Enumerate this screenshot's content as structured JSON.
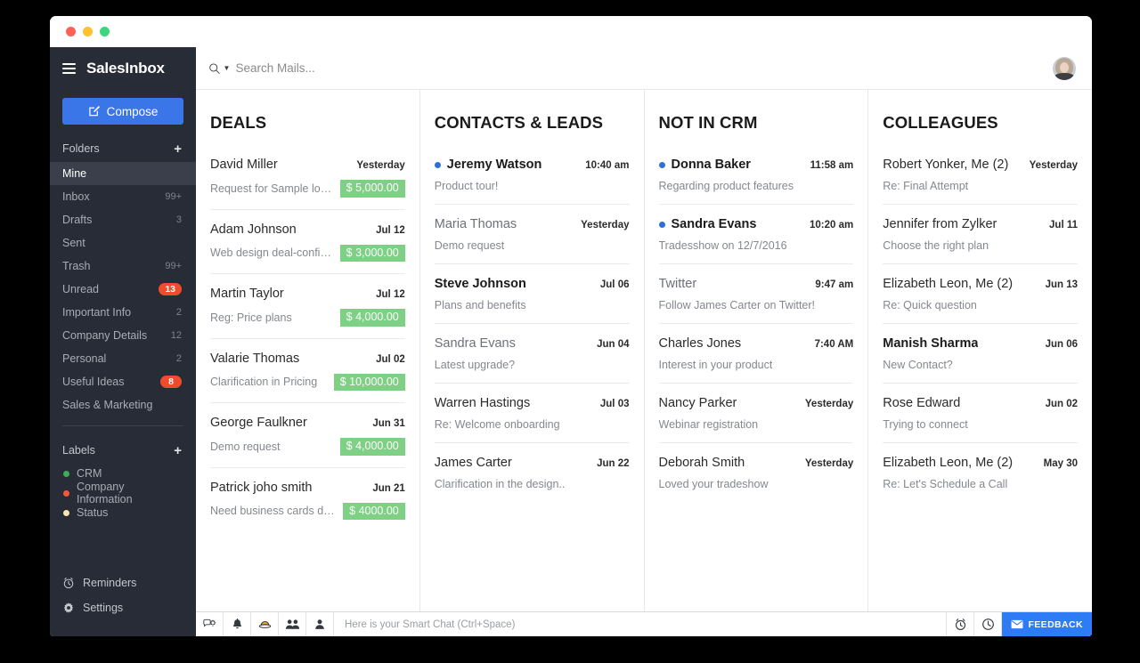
{
  "window": {
    "traffic_lights": [
      "close",
      "minimize",
      "maximize"
    ]
  },
  "sidebar": {
    "brand": "SalesInbox",
    "compose_label": "Compose",
    "folders_heading": "Folders",
    "folders_add": "+",
    "folders": [
      {
        "label": "Mine",
        "count": "",
        "badge": false,
        "active": true
      },
      {
        "label": "Inbox",
        "count": "99+",
        "badge": false,
        "active": false
      },
      {
        "label": "Drafts",
        "count": "3",
        "badge": false,
        "active": false
      },
      {
        "label": "Sent",
        "count": "",
        "badge": false,
        "active": false
      },
      {
        "label": "Trash",
        "count": "99+",
        "badge": false,
        "active": false
      },
      {
        "label": "Unread",
        "count": "13",
        "badge": true,
        "active": false
      },
      {
        "label": "Important Info",
        "count": "2",
        "badge": false,
        "active": false
      },
      {
        "label": "Company Details",
        "count": "12",
        "badge": false,
        "active": false
      },
      {
        "label": "Personal",
        "count": "2",
        "badge": false,
        "active": false
      },
      {
        "label": "Useful Ideas",
        "count": "8",
        "badge": true,
        "active": false
      },
      {
        "label": "Sales & Marketing",
        "count": "",
        "badge": false,
        "active": false
      }
    ],
    "labels_heading": "Labels",
    "labels_add": "+",
    "labels": [
      {
        "label": "CRM",
        "color": "#3cae5b"
      },
      {
        "label": "Company Information",
        "color": "#f0593a"
      },
      {
        "label": "Status",
        "color": "#f7e7b4"
      }
    ],
    "bottom": [
      {
        "label": "Reminders",
        "icon": "alarm-clock-icon"
      },
      {
        "label": "Settings",
        "icon": "gear-icon"
      }
    ]
  },
  "topbar": {
    "search_placeholder": "Search Mails...",
    "search_value": "",
    "search_icon": "search-icon",
    "search_caret": "chevron-down-icon",
    "avatar": "user-avatar"
  },
  "columns": [
    {
      "title": "DEALS",
      "items": [
        {
          "name": "David Miller",
          "date": "Yesterday",
          "subject": "Request for Sample logo...",
          "amount": "$ 5,000.00",
          "unread": false,
          "name_style": "dark"
        },
        {
          "name": "Adam Johnson",
          "date": "Jul 12",
          "subject": "Web design deal-confirma...",
          "amount": "$ 3,000.00",
          "unread": false,
          "name_style": "dark"
        },
        {
          "name": "Martin Taylor",
          "date": "Jul 12",
          "subject": "Reg: Price plans",
          "amount": "$ 4,000.00",
          "unread": false,
          "name_style": "dark"
        },
        {
          "name": "Valarie Thomas",
          "date": "Jul 02",
          "subject": "Clarification in Pricing",
          "amount": "$ 10,000.00",
          "unread": false,
          "name_style": "dark"
        },
        {
          "name": "George Faulkner",
          "date": "Jun 31",
          "subject": "Demo request",
          "amount": "$ 4,000.00",
          "unread": false,
          "name_style": "dark"
        },
        {
          "name": "Patrick joho smith",
          "date": "Jun 21",
          "subject": "Need business cards desi....",
          "amount": "$ 4000.00",
          "unread": false,
          "name_style": "dark"
        }
      ]
    },
    {
      "title": "CONTACTS & LEADS",
      "items": [
        {
          "name": "Jeremy Watson",
          "date": "10:40 am",
          "subject": "Product tour!",
          "amount": "",
          "unread": true,
          "name_style": "bold"
        },
        {
          "name": "Maria Thomas",
          "date": "Yesterday",
          "subject": "Demo request",
          "amount": "",
          "unread": false,
          "name_style": "light"
        },
        {
          "name": "Steve Johnson",
          "date": "Jul 06",
          "subject": "Plans and benefits",
          "amount": "",
          "unread": false,
          "name_style": "bold"
        },
        {
          "name": "Sandra Evans",
          "date": "Jun 04",
          "subject": "Latest upgrade?",
          "amount": "",
          "unread": false,
          "name_style": "light"
        },
        {
          "name": "Warren Hastings",
          "date": "Jul 03",
          "subject": "Re: Welcome onboarding",
          "amount": "",
          "unread": false,
          "name_style": "dark"
        },
        {
          "name": "James Carter",
          "date": "Jun 22",
          "subject": "Clarification in the design..",
          "amount": "",
          "unread": false,
          "name_style": "dark"
        }
      ]
    },
    {
      "title": "NOT IN CRM",
      "items": [
        {
          "name": "Donna Baker",
          "date": "11:58 am",
          "subject": "Regarding product features",
          "amount": "",
          "unread": true,
          "name_style": "bold"
        },
        {
          "name": "Sandra Evans",
          "date": "10:20 am",
          "subject": "Tradesshow on 12/7/2016",
          "amount": "",
          "unread": true,
          "name_style": "bold"
        },
        {
          "name": "Twitter",
          "date": "9:47 am",
          "subject": "Follow James Carter on Twitter!",
          "amount": "",
          "unread": false,
          "name_style": "light"
        },
        {
          "name": "Charles Jones",
          "date": "7:40 AM",
          "subject": "Interest in your product",
          "amount": "",
          "unread": false,
          "name_style": "dark"
        },
        {
          "name": "Nancy Parker",
          "date": "Yesterday",
          "subject": "Webinar registration",
          "amount": "",
          "unread": false,
          "name_style": "dark"
        },
        {
          "name": "Deborah Smith",
          "date": "Yesterday",
          "subject": "Loved your tradeshow",
          "amount": "",
          "unread": false,
          "name_style": "dark"
        }
      ]
    },
    {
      "title": "COLLEAGUES",
      "items": [
        {
          "name": "Robert Yonker, Me (2)",
          "date": "Yesterday",
          "subject": "Re: Final Attempt",
          "amount": "",
          "unread": false,
          "name_style": "dark"
        },
        {
          "name": "Jennifer from Zylker",
          "date": "Jul 11",
          "subject": "Choose the right plan",
          "amount": "",
          "unread": false,
          "name_style": "dark"
        },
        {
          "name": "Elizabeth Leon, Me (2)",
          "date": "Jun 13",
          "subject": "Re: Quick question",
          "amount": "",
          "unread": false,
          "name_style": "dark"
        },
        {
          "name": "Manish Sharma",
          "date": "Jun 06",
          "subject": "New Contact?",
          "amount": "",
          "unread": false,
          "name_style": "bold"
        },
        {
          "name": "Rose Edward",
          "date": "Jun 02",
          "subject": "Trying to connect",
          "amount": "",
          "unread": false,
          "name_style": "dark"
        },
        {
          "name": "Elizabeth Leon, Me (2)",
          "date": "May 30",
          "subject": "Re: Let's Schedule a Call",
          "amount": "",
          "unread": false,
          "name_style": "dark"
        }
      ]
    }
  ],
  "statusbar": {
    "icons": [
      {
        "icon": "chat-settings-icon"
      },
      {
        "icon": "bell-icon"
      },
      {
        "icon": "smiley-hat-icon"
      },
      {
        "icon": "group-contacts-icon"
      },
      {
        "icon": "single-contact-icon"
      }
    ],
    "chat_placeholder": "Here is your Smart Chat (Ctrl+Space)",
    "right_icons": [
      {
        "icon": "alarm-clock-icon"
      },
      {
        "icon": "clock-icon"
      }
    ],
    "feedback_label": "FEEDBACK",
    "feedback_icon": "envelope-icon"
  },
  "colors": {
    "accent_blue": "#3a76e8",
    "sidebar_bg": "#272c36",
    "amount_green": "#7ed085",
    "badge_red": "#ef4b2c",
    "unread_dot": "#2f6fd8",
    "feedback_blue": "#2e7bf6"
  }
}
